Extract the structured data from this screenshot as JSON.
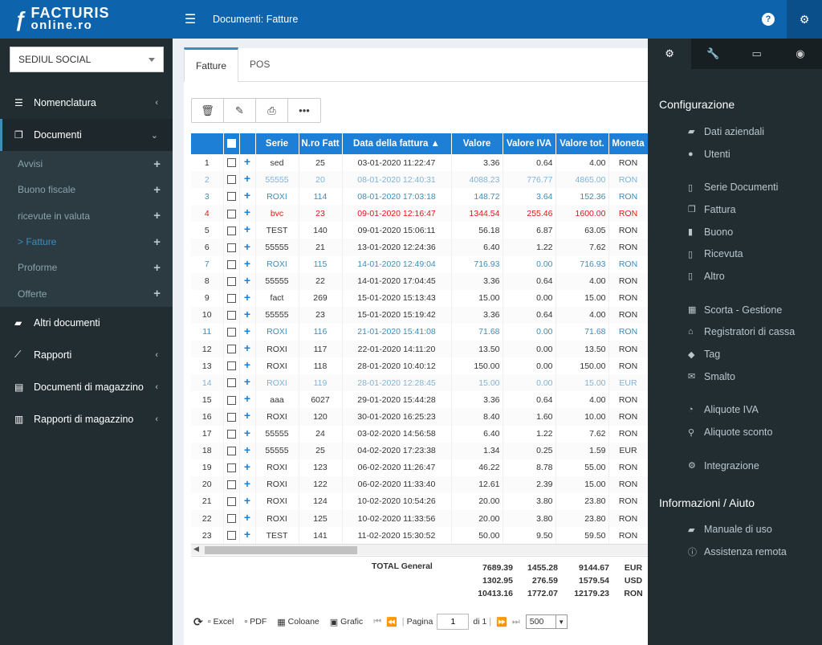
{
  "logo": {
    "line1": "FACTURIS",
    "line2": "online.ro"
  },
  "sidebar": {
    "location_select": "SEDIUL SOCIAL",
    "items": [
      {
        "label": "Nomenclatura",
        "icon": "list-icon"
      },
      {
        "label": "Documenti",
        "icon": "copy-icon"
      },
      {
        "label": "Altri documenti",
        "icon": "folder-icon"
      },
      {
        "label": "Rapporti",
        "icon": "line-chart-icon"
      },
      {
        "label": "Documenti di magazzino",
        "icon": "file-icon"
      },
      {
        "label": "Rapporti di magazzino",
        "icon": "bar-chart-icon"
      }
    ],
    "sub_items": [
      {
        "label": "Avvisi"
      },
      {
        "label": "Buono fiscale"
      },
      {
        "label": "ricevute in valuta"
      },
      {
        "label": "> Fatture"
      },
      {
        "label": "Proforme"
      },
      {
        "label": "Offerte"
      }
    ]
  },
  "header": {
    "title": "Documenti: Fatture"
  },
  "tabs": [
    "Fatture",
    "POS"
  ],
  "table": {
    "columns": [
      "Serie",
      "N.ro Fatt",
      "Data della fattura ▲",
      "Valore",
      "Valore IVA",
      "Valore tot.",
      "Moneta"
    ],
    "rows": [
      {
        "n": "1",
        "serie": "sed",
        "nro": "25",
        "data": "03-01-2020 11:22:47",
        "valore": "3.36",
        "iva": "0.64",
        "tot": "4.00",
        "moneta": "RON",
        "style": ""
      },
      {
        "n": "2",
        "serie": "55555",
        "nro": "20",
        "data": "08-01-2020 12:40:31",
        "valore": "4088.23",
        "iva": "776.77",
        "tot": "4865.00",
        "moneta": "RON",
        "style": "lightblue"
      },
      {
        "n": "3",
        "serie": "ROXI",
        "nro": "114",
        "data": "08-01-2020 17:03:18",
        "valore": "148.72",
        "iva": "3.64",
        "tot": "152.36",
        "moneta": "RON",
        "style": "blue"
      },
      {
        "n": "4",
        "serie": "bvc",
        "nro": "23",
        "data": "09-01-2020 12:16:47",
        "valore": "1344.54",
        "iva": "255.46",
        "tot": "1600.00",
        "moneta": "RON",
        "style": "red"
      },
      {
        "n": "5",
        "serie": "TEST",
        "nro": "140",
        "data": "09-01-2020 15:06:11",
        "valore": "56.18",
        "iva": "6.87",
        "tot": "63.05",
        "moneta": "RON",
        "style": ""
      },
      {
        "n": "6",
        "serie": "55555",
        "nro": "21",
        "data": "13-01-2020 12:24:36",
        "valore": "6.40",
        "iva": "1.22",
        "tot": "7.62",
        "moneta": "RON",
        "style": ""
      },
      {
        "n": "7",
        "serie": "ROXI",
        "nro": "115",
        "data": "14-01-2020 12:49:04",
        "valore": "716.93",
        "iva": "0.00",
        "tot": "716.93",
        "moneta": "RON",
        "style": "blue"
      },
      {
        "n": "8",
        "serie": "55555",
        "nro": "22",
        "data": "14-01-2020 17:04:45",
        "valore": "3.36",
        "iva": "0.64",
        "tot": "4.00",
        "moneta": "RON",
        "style": ""
      },
      {
        "n": "9",
        "serie": "fact",
        "nro": "269",
        "data": "15-01-2020 15:13:43",
        "valore": "15.00",
        "iva": "0.00",
        "tot": "15.00",
        "moneta": "RON",
        "style": ""
      },
      {
        "n": "10",
        "serie": "55555",
        "nro": "23",
        "data": "15-01-2020 15:19:42",
        "valore": "3.36",
        "iva": "0.64",
        "tot": "4.00",
        "moneta": "RON",
        "style": ""
      },
      {
        "n": "11",
        "serie": "ROXI",
        "nro": "116",
        "data": "21-01-2020 15:41:08",
        "valore": "71.68",
        "iva": "0.00",
        "tot": "71.68",
        "moneta": "RON",
        "style": "blue"
      },
      {
        "n": "12",
        "serie": "ROXI",
        "nro": "117",
        "data": "22-01-2020 14:11:20",
        "valore": "13.50",
        "iva": "0.00",
        "tot": "13.50",
        "moneta": "RON",
        "style": ""
      },
      {
        "n": "13",
        "serie": "ROXI",
        "nro": "118",
        "data": "28-01-2020 10:40:12",
        "valore": "150.00",
        "iva": "0.00",
        "tot": "150.00",
        "moneta": "RON",
        "style": ""
      },
      {
        "n": "14",
        "serie": "ROXI",
        "nro": "119",
        "data": "28-01-2020 12:28:45",
        "valore": "15.00",
        "iva": "0.00",
        "tot": "15.00",
        "moneta": "EUR",
        "style": "lightblue"
      },
      {
        "n": "15",
        "serie": "aaa",
        "nro": "6027",
        "data": "29-01-2020 15:44:28",
        "valore": "3.36",
        "iva": "0.64",
        "tot": "4.00",
        "moneta": "RON",
        "style": ""
      },
      {
        "n": "16",
        "serie": "ROXI",
        "nro": "120",
        "data": "30-01-2020 16:25:23",
        "valore": "8.40",
        "iva": "1.60",
        "tot": "10.00",
        "moneta": "RON",
        "style": ""
      },
      {
        "n": "17",
        "serie": "55555",
        "nro": "24",
        "data": "03-02-2020 14:56:58",
        "valore": "6.40",
        "iva": "1.22",
        "tot": "7.62",
        "moneta": "RON",
        "style": ""
      },
      {
        "n": "18",
        "serie": "55555",
        "nro": "25",
        "data": "04-02-2020 17:23:38",
        "valore": "1.34",
        "iva": "0.25",
        "tot": "1.59",
        "moneta": "EUR",
        "style": ""
      },
      {
        "n": "19",
        "serie": "ROXI",
        "nro": "123",
        "data": "06-02-2020 11:26:47",
        "valore": "46.22",
        "iva": "8.78",
        "tot": "55.00",
        "moneta": "RON",
        "style": ""
      },
      {
        "n": "20",
        "serie": "ROXI",
        "nro": "122",
        "data": "06-02-2020 11:33:40",
        "valore": "12.61",
        "iva": "2.39",
        "tot": "15.00",
        "moneta": "RON",
        "style": ""
      },
      {
        "n": "21",
        "serie": "ROXI",
        "nro": "124",
        "data": "10-02-2020 10:54:26",
        "valore": "20.00",
        "iva": "3.80",
        "tot": "23.80",
        "moneta": "RON",
        "style": ""
      },
      {
        "n": "22",
        "serie": "ROXI",
        "nro": "125",
        "data": "10-02-2020 11:33:56",
        "valore": "20.00",
        "iva": "3.80",
        "tot": "23.80",
        "moneta": "RON",
        "style": ""
      },
      {
        "n": "23",
        "serie": "TEST",
        "nro": "141",
        "data": "11-02-2020 15:30:52",
        "valore": "50.00",
        "iva": "9.50",
        "tot": "59.50",
        "moneta": "RON",
        "style": ""
      }
    ]
  },
  "totals": {
    "label": "TOTAL General",
    "valore": [
      "7689.39",
      "1302.95",
      "10413.16"
    ],
    "iva": [
      "1455.28",
      "276.59",
      "1772.07"
    ],
    "tot": [
      "9144.67",
      "1579.54",
      "12179.23"
    ],
    "moneta": [
      "EUR",
      "USD",
      "RON"
    ]
  },
  "pager": {
    "excel": "Excel",
    "pdf": "PDF",
    "colonne": "Coloane",
    "grafic": "Grafic",
    "pagina": "Pagina",
    "page_value": "1",
    "of": "di 1",
    "page_size": "500"
  },
  "rpanel": {
    "heading1": "Configurazione",
    "heading2": "Informazioni / Aiuto",
    "items": [
      {
        "label": "Dati aziendali",
        "icon": "book-icon"
      },
      {
        "label": "Utenti",
        "icon": "user-icon"
      },
      {
        "label": "Serie Documenti",
        "icon": "document-icon"
      },
      {
        "label": "Fattura",
        "icon": "copy-icon"
      },
      {
        "label": "Buono",
        "icon": "file-icon"
      },
      {
        "label": "Ricevuta",
        "icon": "document-icon"
      },
      {
        "label": "Altro",
        "icon": "document-icon"
      },
      {
        "label": "Scorta - Gestione",
        "icon": "grid-icon"
      },
      {
        "label": "Registratori di cassa",
        "icon": "cash-register-icon"
      },
      {
        "label": "Tag",
        "icon": "tag-icon"
      },
      {
        "label": "Smalto",
        "icon": "envelope-icon"
      },
      {
        "label": "Aliquote IVA",
        "icon": "dashboard-icon"
      },
      {
        "label": "Aliquote sconto",
        "icon": "search-icon"
      },
      {
        "label": "Integrazione",
        "icon": "gears-icon"
      }
    ],
    "help_items": [
      {
        "label": "Manuale di uso",
        "icon": "book-icon"
      },
      {
        "label": "Assistenza remota",
        "icon": "info-icon"
      }
    ]
  },
  "colors": {
    "header": "#0d64ad",
    "sidebar": "#222d32",
    "grid_header": "#1e7fd6",
    "row_red": "#e41515",
    "row_blue": "#3c8dbc"
  }
}
